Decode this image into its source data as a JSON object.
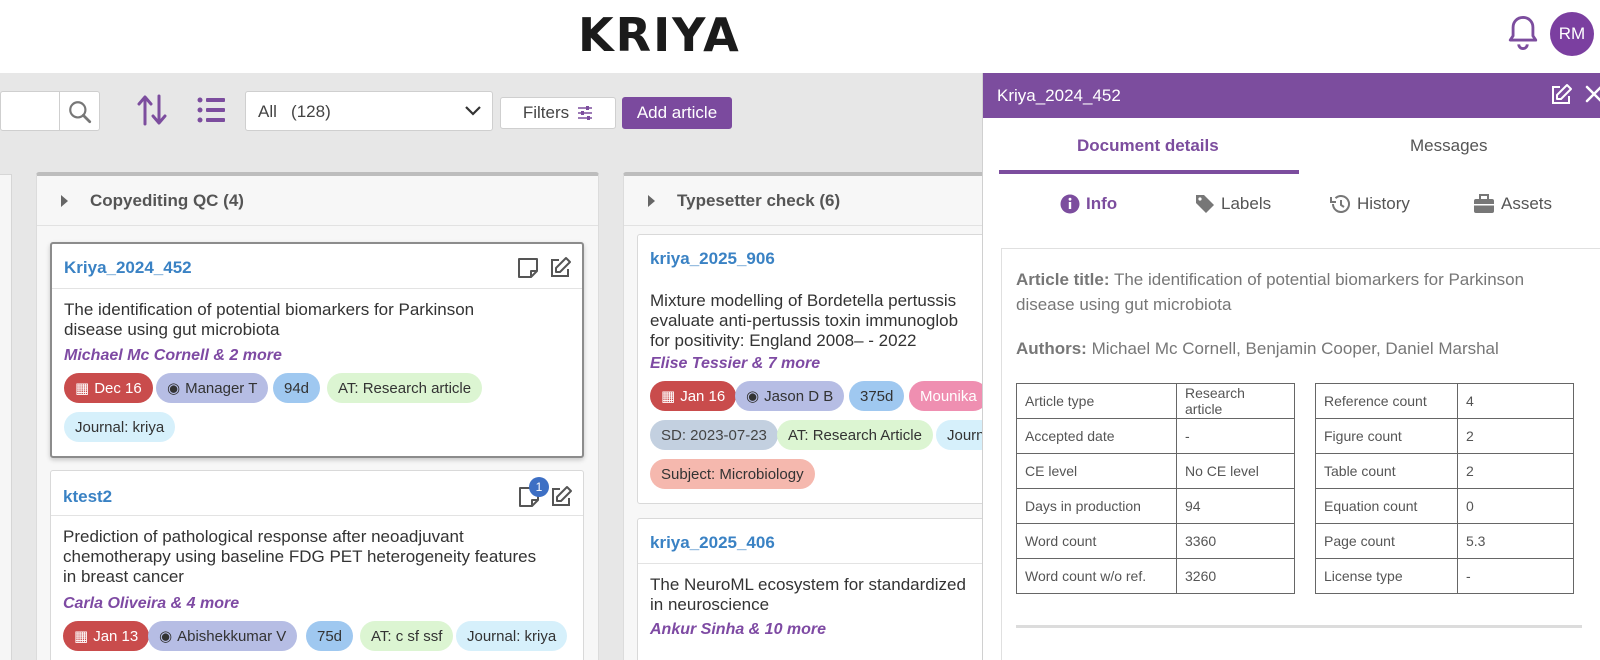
{
  "header": {
    "brand": "KRIYA",
    "avatar_initials": "RM"
  },
  "toolbar": {
    "select_value": "All   (128)",
    "filters_label": "Filters",
    "add_label": "Add article"
  },
  "columns": [
    {
      "title": "Copyediting QC (4)"
    },
    {
      "title": "Typesetter check (6)"
    }
  ],
  "cards": {
    "c1": {
      "id": "Kriya_2024_452",
      "title_lines": [
        "The identification of potential biomarkers for Parkinson",
        "disease using gut microbiota"
      ],
      "authors": "Michael Mc Cornell & 2 more",
      "date": "Dec 16",
      "user": "Manager T",
      "days": "94d",
      "at": "AT: Research article",
      "journal": "Journal: kriya"
    },
    "c2": {
      "id": "ktest2",
      "badge": "1",
      "title_lines": [
        "Prediction of pathological response after neoadjuvant",
        "chemotherapy using baseline FDG PET heterogeneity features",
        "in breast cancer"
      ],
      "authors": "Carla Oliveira & 4 more",
      "date": "Jan 13",
      "user": "Abishekkumar V",
      "days": "75d",
      "at": "AT: c sf ssf",
      "journal": "Journal: kriya"
    },
    "c3": {
      "id": "kriya_2025_906",
      "title_lines": [
        "Mixture modelling of Bordetella pertussis",
        "evaluate anti-pertussis toxin immunoglob",
        "for positivity: England 2008– - 2022"
      ],
      "authors": "Elise Tessier & 7 more",
      "date": "Jan 16",
      "user": "Jason D B",
      "days": "375d",
      "extra": "Mounika",
      "sd": "SD: 2023-07-23",
      "at": "AT: Research Article",
      "journal": "Journ",
      "subject": "Subject: Microbiology"
    },
    "c4": {
      "id": "kriya_2025_406",
      "title_lines": [
        "The NeuroML ecosystem for standardized",
        "in neuroscience"
      ],
      "authors": "Ankur Sinha & 10 more"
    }
  },
  "panel": {
    "title": "Kriya_2024_452",
    "tabs": [
      "Document details",
      "Messages"
    ],
    "subtabs": [
      "Info",
      "Labels",
      "History",
      "Assets"
    ],
    "article_title_label": "Article title:",
    "article_title": "The identification of potential biomarkers for Parkinson disease using gut microbiota",
    "authors_label": "Authors:",
    "authors": "Michael Mc Cornell, Benjamin Cooper, Daniel Marshal",
    "left_table": [
      [
        "Article type",
        "Research article"
      ],
      [
        "Accepted date",
        "-"
      ],
      [
        "CE level",
        "No CE level"
      ],
      [
        "Days in production",
        "94"
      ],
      [
        "Word count",
        "3360"
      ],
      [
        "Word count w/o ref.",
        "3260"
      ]
    ],
    "right_table": [
      [
        "Reference count",
        "4"
      ],
      [
        "Figure count",
        "2"
      ],
      [
        "Table count",
        "2"
      ],
      [
        "Equation count",
        "0"
      ],
      [
        "Page count",
        "5.3"
      ],
      [
        "License type",
        "-"
      ]
    ]
  },
  "colors": {
    "brand_purple": "#7c4d9e",
    "link_blue": "#3a82c4",
    "date_red": "#c94c4c"
  }
}
